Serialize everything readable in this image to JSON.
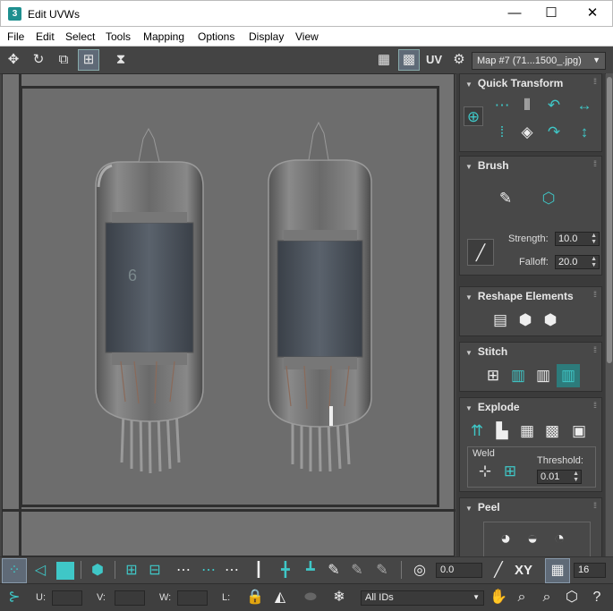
{
  "window": {
    "title": "Edit UVWs",
    "app_icon_text": "3",
    "controls": {
      "minimize": "—",
      "maximize": "☐",
      "close": "✕"
    }
  },
  "menu": [
    "File",
    "Edit",
    "Select",
    "Tools",
    "Mapping",
    "Options",
    "Display",
    "View"
  ],
  "toolbar": {
    "uv_label": "UV",
    "map_dropdown": "Map #7 (71...1500_.jpg)"
  },
  "panel": {
    "quick_transform": {
      "title": "Quick Transform"
    },
    "brush": {
      "title": "Brush",
      "strength_label": "Strength:",
      "strength_value": "10.0",
      "falloff_label": "Falloff:",
      "falloff_value": "20.0"
    },
    "reshape": {
      "title": "Reshape Elements"
    },
    "stitch": {
      "title": "Stitch"
    },
    "explode": {
      "title": "Explode",
      "weld_label": "Weld",
      "threshold_label": "Threshold:",
      "threshold_value": "0.01"
    },
    "peel": {
      "title": "Peel"
    }
  },
  "bottom": {
    "angle_value": "0.0",
    "xy_label": "XY",
    "grid_value": "16",
    "u_label": "U:",
    "v_label": "V:",
    "w_label": "W:",
    "l_label": "L:",
    "ids_dropdown": "All IDs"
  },
  "colors": {
    "accent": "#3fc7c7",
    "bg": "#444444",
    "viewport": "#727272"
  }
}
